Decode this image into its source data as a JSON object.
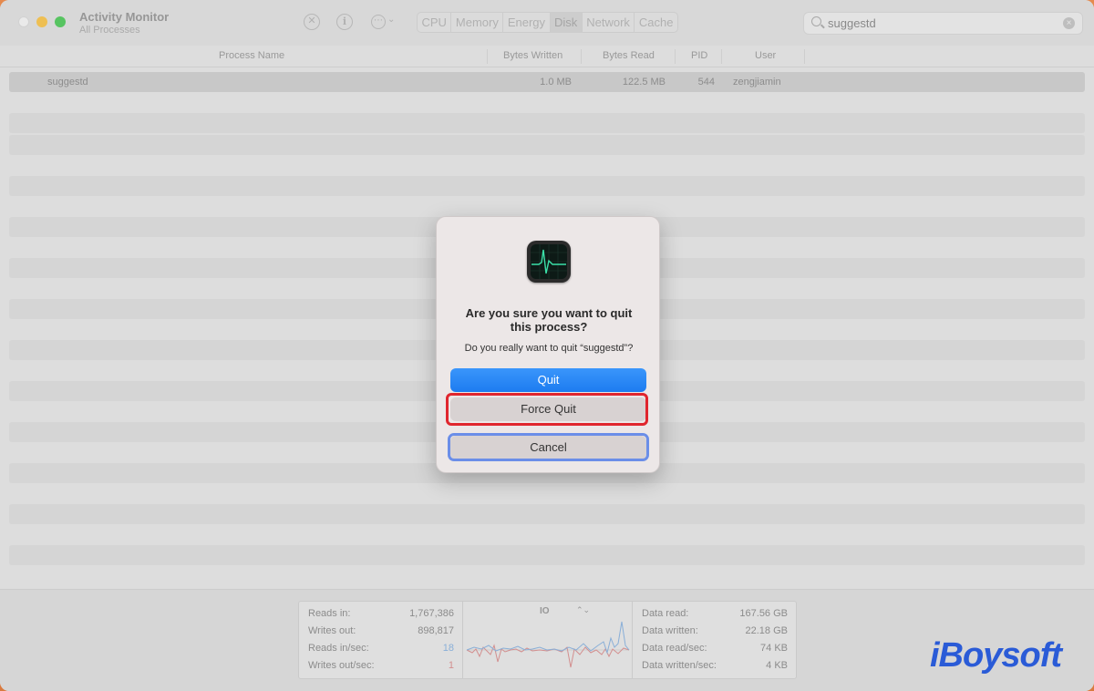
{
  "window": {
    "title": "Activity Monitor",
    "subtitle": "All Processes"
  },
  "toolbar": {
    "tabs": [
      {
        "label": "CPU",
        "active": false
      },
      {
        "label": "Memory",
        "active": false
      },
      {
        "label": "Energy",
        "active": false
      },
      {
        "label": "Disk",
        "active": true
      },
      {
        "label": "Network",
        "active": false
      },
      {
        "label": "Cache",
        "active": false
      }
    ],
    "search_value": "suggestd",
    "icons": [
      "stop-icon",
      "info-icon",
      "more-icon",
      "chevron-down-icon"
    ]
  },
  "table": {
    "columns": [
      "Process Name",
      "Bytes Written",
      "Bytes Read",
      "PID",
      "User"
    ],
    "rows": [
      {
        "name": "suggestd",
        "bytes_written": "1.0 MB",
        "bytes_read": "122.5 MB",
        "pid": "544",
        "user": "zengjiamin"
      }
    ]
  },
  "footer": {
    "left": [
      {
        "label": "Reads in:",
        "value": "1,767,386"
      },
      {
        "label": "Writes out:",
        "value": "898,817"
      },
      {
        "label": "Reads in/sec:",
        "value": "18"
      },
      {
        "label": "Writes out/sec:",
        "value": "1"
      }
    ],
    "graph_label": "IO",
    "right": [
      {
        "label": "Data read:",
        "value": "167.56 GB"
      },
      {
        "label": "Data written:",
        "value": "22.18 GB"
      },
      {
        "label": "Data read/sec:",
        "value": "74 KB"
      },
      {
        "label": "Data written/sec:",
        "value": "4 KB"
      }
    ],
    "colors": {
      "reads": "#7aa6d6",
      "writes": "#d08080"
    }
  },
  "dialog": {
    "title": "Are you sure you want to quit this process?",
    "message": "Do you really want to quit “suggestd”?",
    "buttons": {
      "quit": "Quit",
      "force_quit": "Force Quit",
      "cancel": "Cancel"
    },
    "colors": {
      "primary": "#1d7cf0",
      "highlight": "#e0262e",
      "focus": "#6b8ee8"
    }
  },
  "watermark": "iBoysoft"
}
